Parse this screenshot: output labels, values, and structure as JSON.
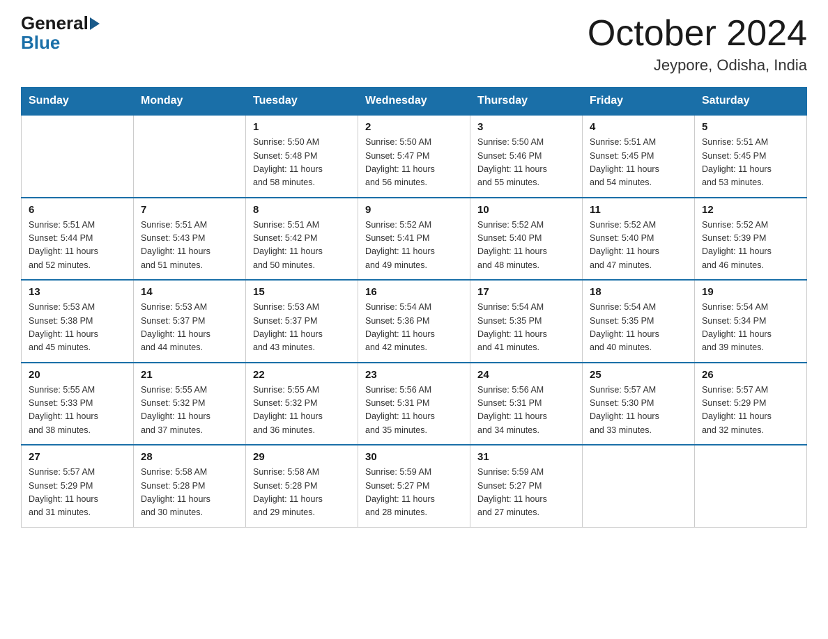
{
  "header": {
    "logo_general": "General",
    "logo_blue": "Blue",
    "month_title": "October 2024",
    "location": "Jeypore, Odisha, India"
  },
  "weekdays": [
    "Sunday",
    "Monday",
    "Tuesday",
    "Wednesday",
    "Thursday",
    "Friday",
    "Saturday"
  ],
  "weeks": [
    [
      {
        "day": "",
        "info": ""
      },
      {
        "day": "",
        "info": ""
      },
      {
        "day": "1",
        "info": "Sunrise: 5:50 AM\nSunset: 5:48 PM\nDaylight: 11 hours\nand 58 minutes."
      },
      {
        "day": "2",
        "info": "Sunrise: 5:50 AM\nSunset: 5:47 PM\nDaylight: 11 hours\nand 56 minutes."
      },
      {
        "day": "3",
        "info": "Sunrise: 5:50 AM\nSunset: 5:46 PM\nDaylight: 11 hours\nand 55 minutes."
      },
      {
        "day": "4",
        "info": "Sunrise: 5:51 AM\nSunset: 5:45 PM\nDaylight: 11 hours\nand 54 minutes."
      },
      {
        "day": "5",
        "info": "Sunrise: 5:51 AM\nSunset: 5:45 PM\nDaylight: 11 hours\nand 53 minutes."
      }
    ],
    [
      {
        "day": "6",
        "info": "Sunrise: 5:51 AM\nSunset: 5:44 PM\nDaylight: 11 hours\nand 52 minutes."
      },
      {
        "day": "7",
        "info": "Sunrise: 5:51 AM\nSunset: 5:43 PM\nDaylight: 11 hours\nand 51 minutes."
      },
      {
        "day": "8",
        "info": "Sunrise: 5:51 AM\nSunset: 5:42 PM\nDaylight: 11 hours\nand 50 minutes."
      },
      {
        "day": "9",
        "info": "Sunrise: 5:52 AM\nSunset: 5:41 PM\nDaylight: 11 hours\nand 49 minutes."
      },
      {
        "day": "10",
        "info": "Sunrise: 5:52 AM\nSunset: 5:40 PM\nDaylight: 11 hours\nand 48 minutes."
      },
      {
        "day": "11",
        "info": "Sunrise: 5:52 AM\nSunset: 5:40 PM\nDaylight: 11 hours\nand 47 minutes."
      },
      {
        "day": "12",
        "info": "Sunrise: 5:52 AM\nSunset: 5:39 PM\nDaylight: 11 hours\nand 46 minutes."
      }
    ],
    [
      {
        "day": "13",
        "info": "Sunrise: 5:53 AM\nSunset: 5:38 PM\nDaylight: 11 hours\nand 45 minutes."
      },
      {
        "day": "14",
        "info": "Sunrise: 5:53 AM\nSunset: 5:37 PM\nDaylight: 11 hours\nand 44 minutes."
      },
      {
        "day": "15",
        "info": "Sunrise: 5:53 AM\nSunset: 5:37 PM\nDaylight: 11 hours\nand 43 minutes."
      },
      {
        "day": "16",
        "info": "Sunrise: 5:54 AM\nSunset: 5:36 PM\nDaylight: 11 hours\nand 42 minutes."
      },
      {
        "day": "17",
        "info": "Sunrise: 5:54 AM\nSunset: 5:35 PM\nDaylight: 11 hours\nand 41 minutes."
      },
      {
        "day": "18",
        "info": "Sunrise: 5:54 AM\nSunset: 5:35 PM\nDaylight: 11 hours\nand 40 minutes."
      },
      {
        "day": "19",
        "info": "Sunrise: 5:54 AM\nSunset: 5:34 PM\nDaylight: 11 hours\nand 39 minutes."
      }
    ],
    [
      {
        "day": "20",
        "info": "Sunrise: 5:55 AM\nSunset: 5:33 PM\nDaylight: 11 hours\nand 38 minutes."
      },
      {
        "day": "21",
        "info": "Sunrise: 5:55 AM\nSunset: 5:32 PM\nDaylight: 11 hours\nand 37 minutes."
      },
      {
        "day": "22",
        "info": "Sunrise: 5:55 AM\nSunset: 5:32 PM\nDaylight: 11 hours\nand 36 minutes."
      },
      {
        "day": "23",
        "info": "Sunrise: 5:56 AM\nSunset: 5:31 PM\nDaylight: 11 hours\nand 35 minutes."
      },
      {
        "day": "24",
        "info": "Sunrise: 5:56 AM\nSunset: 5:31 PM\nDaylight: 11 hours\nand 34 minutes."
      },
      {
        "day": "25",
        "info": "Sunrise: 5:57 AM\nSunset: 5:30 PM\nDaylight: 11 hours\nand 33 minutes."
      },
      {
        "day": "26",
        "info": "Sunrise: 5:57 AM\nSunset: 5:29 PM\nDaylight: 11 hours\nand 32 minutes."
      }
    ],
    [
      {
        "day": "27",
        "info": "Sunrise: 5:57 AM\nSunset: 5:29 PM\nDaylight: 11 hours\nand 31 minutes."
      },
      {
        "day": "28",
        "info": "Sunrise: 5:58 AM\nSunset: 5:28 PM\nDaylight: 11 hours\nand 30 minutes."
      },
      {
        "day": "29",
        "info": "Sunrise: 5:58 AM\nSunset: 5:28 PM\nDaylight: 11 hours\nand 29 minutes."
      },
      {
        "day": "30",
        "info": "Sunrise: 5:59 AM\nSunset: 5:27 PM\nDaylight: 11 hours\nand 28 minutes."
      },
      {
        "day": "31",
        "info": "Sunrise: 5:59 AM\nSunset: 5:27 PM\nDaylight: 11 hours\nand 27 minutes."
      },
      {
        "day": "",
        "info": ""
      },
      {
        "day": "",
        "info": ""
      }
    ]
  ]
}
